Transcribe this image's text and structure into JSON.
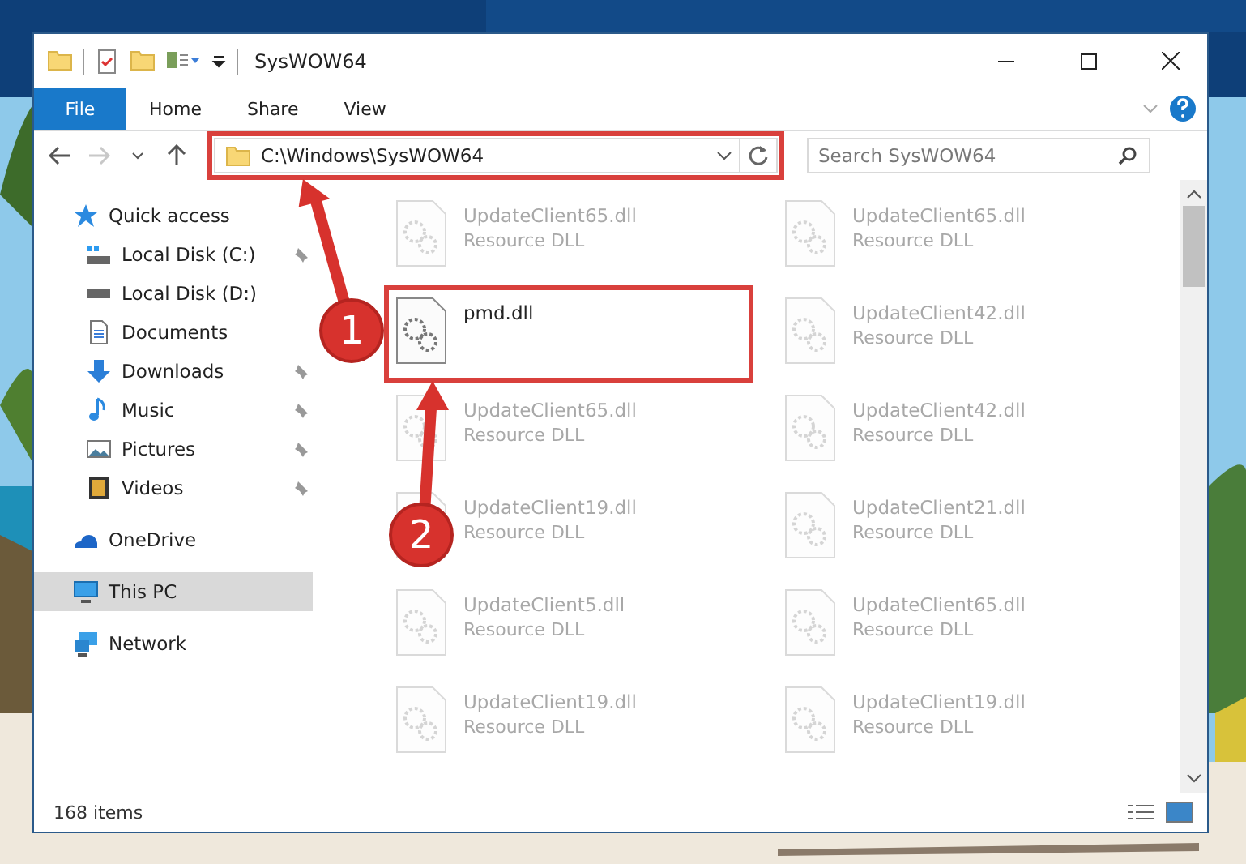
{
  "window": {
    "title": "SysWOW64"
  },
  "ribbon": {
    "tabs": [
      {
        "label": "File",
        "selected": true
      },
      {
        "label": "Home",
        "selected": false
      },
      {
        "label": "Share",
        "selected": false
      },
      {
        "label": "View",
        "selected": false
      }
    ]
  },
  "nav": [
    {
      "kind": "back",
      "disabled": false
    },
    {
      "kind": "forward",
      "disabled": true
    },
    {
      "kind": "recent",
      "disabled": false
    },
    {
      "kind": "up",
      "disabled": false
    }
  ],
  "address": {
    "value": "C:\\Windows\\SysWOW64",
    "highlighted": true
  },
  "search": {
    "placeholder": "Search SysWOW64"
  },
  "sidebar": {
    "items": [
      {
        "label": "Quick access",
        "kind": "star",
        "selected": false,
        "children": [
          {
            "label": "Local Disk (C:)",
            "kind": "drive-c",
            "selected": false,
            "pinned": true
          },
          {
            "label": "Local Disk (D:)",
            "kind": "drive",
            "selected": false,
            "pinned": false
          },
          {
            "label": "Documents",
            "kind": "doc",
            "selected": false,
            "pinned": false
          },
          {
            "label": "Downloads",
            "kind": "download",
            "selected": false,
            "pinned": true
          },
          {
            "label": "Music",
            "kind": "music",
            "selected": false,
            "pinned": true
          },
          {
            "label": "Pictures",
            "kind": "pictures",
            "selected": false,
            "pinned": true
          },
          {
            "label": "Videos",
            "kind": "videos",
            "selected": false,
            "pinned": true
          }
        ]
      },
      {
        "label": "OneDrive",
        "kind": "cloud",
        "selected": false
      },
      {
        "label": "This PC",
        "kind": "pc",
        "selected": true
      },
      {
        "label": "Network",
        "kind": "network",
        "selected": false
      }
    ]
  },
  "files": [
    {
      "name": "UpdateClient65.dll",
      "type": "Resource DLL",
      "faded": true,
      "highlighted": false
    },
    {
      "name": "UpdateClient65.dll",
      "type": "Resource DLL",
      "faded": true,
      "highlighted": false
    },
    {
      "name": "pmd.dll",
      "faded": false,
      "highlighted": true
    },
    {
      "name": "UpdateClient42.dll",
      "type": "Resource DLL",
      "faded": true,
      "highlighted": false
    },
    {
      "name": "UpdateClient65.dll",
      "type": "Resource DLL",
      "faded": true,
      "highlighted": false
    },
    {
      "name": "UpdateClient42.dll",
      "type": "Resource DLL",
      "faded": true,
      "highlighted": false
    },
    {
      "name": "UpdateClient19.dll",
      "type": "Resource DLL",
      "faded": true,
      "highlighted": false
    },
    {
      "name": "UpdateClient21.dll",
      "type": "Resource DLL",
      "faded": true,
      "highlighted": false
    },
    {
      "name": "UpdateClient5.dll",
      "type": "Resource DLL",
      "faded": true,
      "highlighted": false
    },
    {
      "name": "UpdateClient65.dll",
      "type": "Resource DLL",
      "faded": true,
      "highlighted": false
    },
    {
      "name": "UpdateClient19.dll",
      "type": "Resource DLL",
      "faded": true,
      "highlighted": false
    },
    {
      "name": "UpdateClient19.dll",
      "type": "Resource DLL",
      "faded": true,
      "highlighted": false
    }
  ],
  "status_bar": {
    "count": "168 items"
  },
  "annotations": [
    {
      "label": "1"
    },
    {
      "label": "2"
    }
  ]
}
